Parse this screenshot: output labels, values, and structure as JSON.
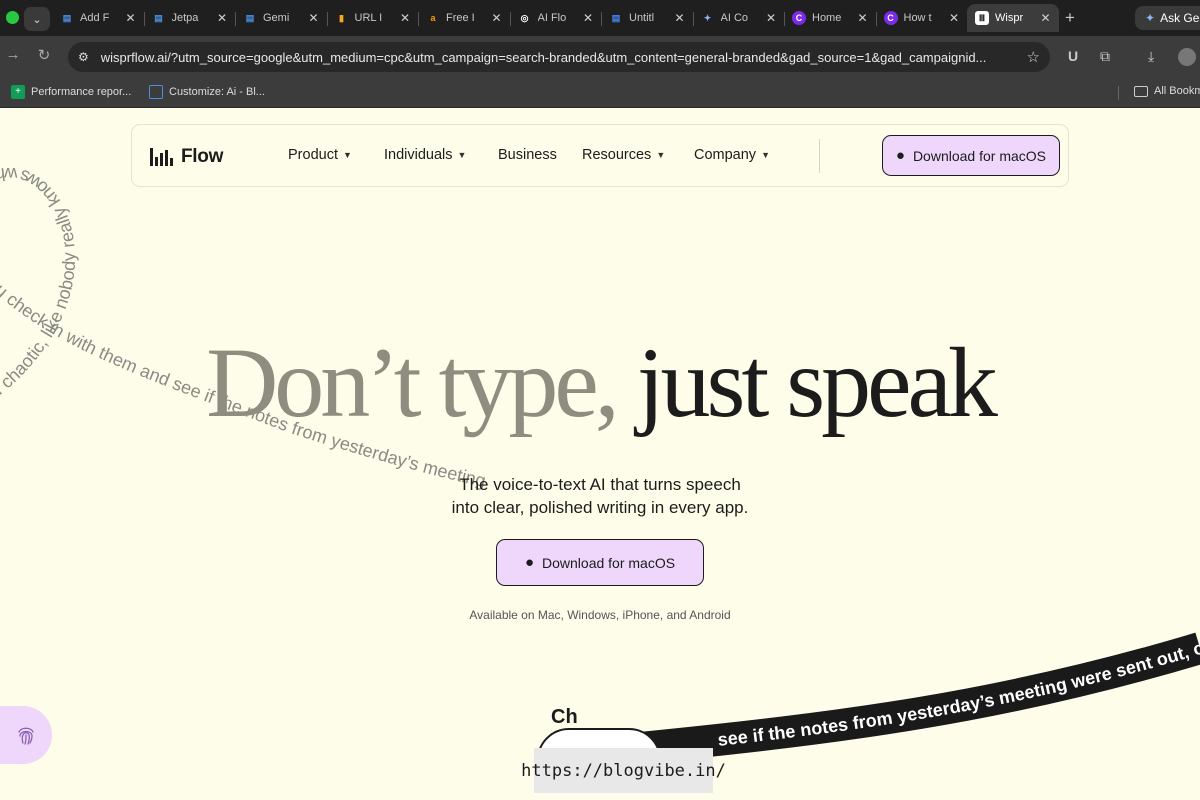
{
  "browser": {
    "tabs": [
      {
        "title": "Add F",
        "icon": "doc-icon",
        "color": "#4a90e2"
      },
      {
        "title": "Jetpa",
        "icon": "doc-icon",
        "color": "#4a90e2"
      },
      {
        "title": "Gemi",
        "icon": "doc-icon",
        "color": "#4a90e2"
      },
      {
        "title": "URL I",
        "icon": "analytics-icon",
        "color": "#f5a623"
      },
      {
        "title": "Free I",
        "icon": "amazon-icon",
        "color": "#ff9900"
      },
      {
        "title": "AI Flo",
        "icon": "openai-icon",
        "color": "#ffffff"
      },
      {
        "title": "Untitl",
        "icon": "doc-icon",
        "color": "#4285f4"
      },
      {
        "title": "AI Co",
        "icon": "gemini-icon",
        "color": "#8ab4f8"
      },
      {
        "title": "Home",
        "icon": "canva-icon",
        "color": "#7d2ae8"
      },
      {
        "title": "How t",
        "icon": "canva-icon",
        "color": "#7d2ae8"
      },
      {
        "title": "Wispr",
        "icon": "wispr-icon",
        "color": "#111111",
        "active": true
      }
    ],
    "ask_gemini": "Ask Ge",
    "url": "wisprflow.ai/?utm_source=google&utm_medium=cpc&utm_campaign=search-branded&utm_content=general-branded&gad_source=1&gad_campaignid...",
    "bookmarks": [
      {
        "label": "Performance repor...",
        "icon": "sheets-icon",
        "color": "#0f9d58"
      },
      {
        "label": "Customize: Ai - Bl...",
        "icon": "doc-icon",
        "color": "#4a90e2"
      }
    ],
    "all_bookmarks": "All Bookm"
  },
  "site": {
    "logo_text": "Flow",
    "nav": {
      "product": "Product",
      "individuals": "Individuals",
      "business": "Business",
      "resources": "Resources",
      "company": "Company"
    },
    "cta_nav": "Download for macOS"
  },
  "hero": {
    "title_light": "Don’t type,",
    "title_dark": "just speak",
    "subtitle_line1": "The voice-to-text AI that turns speech",
    "subtitle_line2": "into clear, polished writing in every app.",
    "cta": "Download for macOS",
    "availability": "Available on Mac, Windows, iPhone, and Android"
  },
  "curve_text": {
    "gray": "kind of chaotic, like nobody really knows what's going on, so you check in with them and see if the notes from yesterday’s meeting",
    "black": "see if the notes from yesterday’s meeting were sent out, o"
  },
  "bubble_text": "Ch",
  "watermark": "https://blogvibe.in/",
  "colors": {
    "page_bg": "#fdfdea",
    "accent": "#eed7fa",
    "ink": "#1c1c1c",
    "muted": "#8e8d80"
  }
}
